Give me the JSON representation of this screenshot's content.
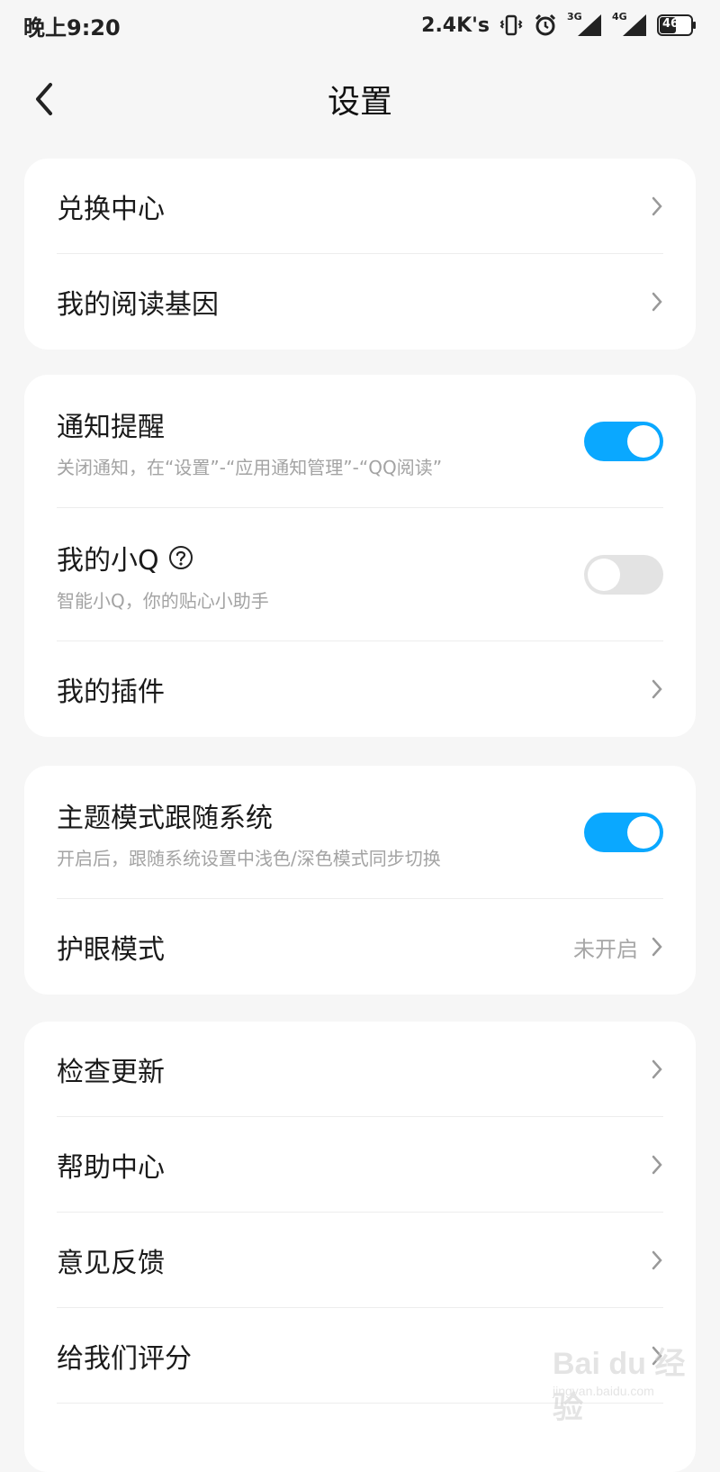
{
  "status_bar": {
    "time": "晚上9:20",
    "net_speed": "2.4K's",
    "signal_3g": "3G",
    "signal_4g": "4G",
    "battery_level": "46"
  },
  "nav": {
    "title": "设置"
  },
  "group1": {
    "exchange_center": "兑换中心",
    "reading_genes": "我的阅读基因"
  },
  "group2": {
    "notifications": {
      "label": "通知提醒",
      "sub": "关闭通知，在“设置”-“应用通知管理”-“QQ阅读”",
      "state": "on"
    },
    "my_xiaoq": {
      "label": "我的小Q",
      "sub": "智能小Q，你的贴心小助手",
      "state": "off"
    },
    "plugins": "我的插件"
  },
  "group3": {
    "theme_follow": {
      "label": "主题模式跟随系统",
      "sub": "开启后，跟随系统设置中浅色/深色模式同步切换",
      "state": "on"
    },
    "eye_care": {
      "label": "护眼模式",
      "value": "未开启"
    }
  },
  "group4": {
    "check_update": "检查更新",
    "help_center": "帮助中心",
    "feedback": "意见反馈",
    "rate_us": "给我们评分"
  },
  "watermark": {
    "main": "Bai du 经验",
    "sub": "jingyan.baidu.com"
  },
  "colors": {
    "accent": "#0aa8ff",
    "background": "#f6f6f6",
    "card": "#ffffff"
  }
}
